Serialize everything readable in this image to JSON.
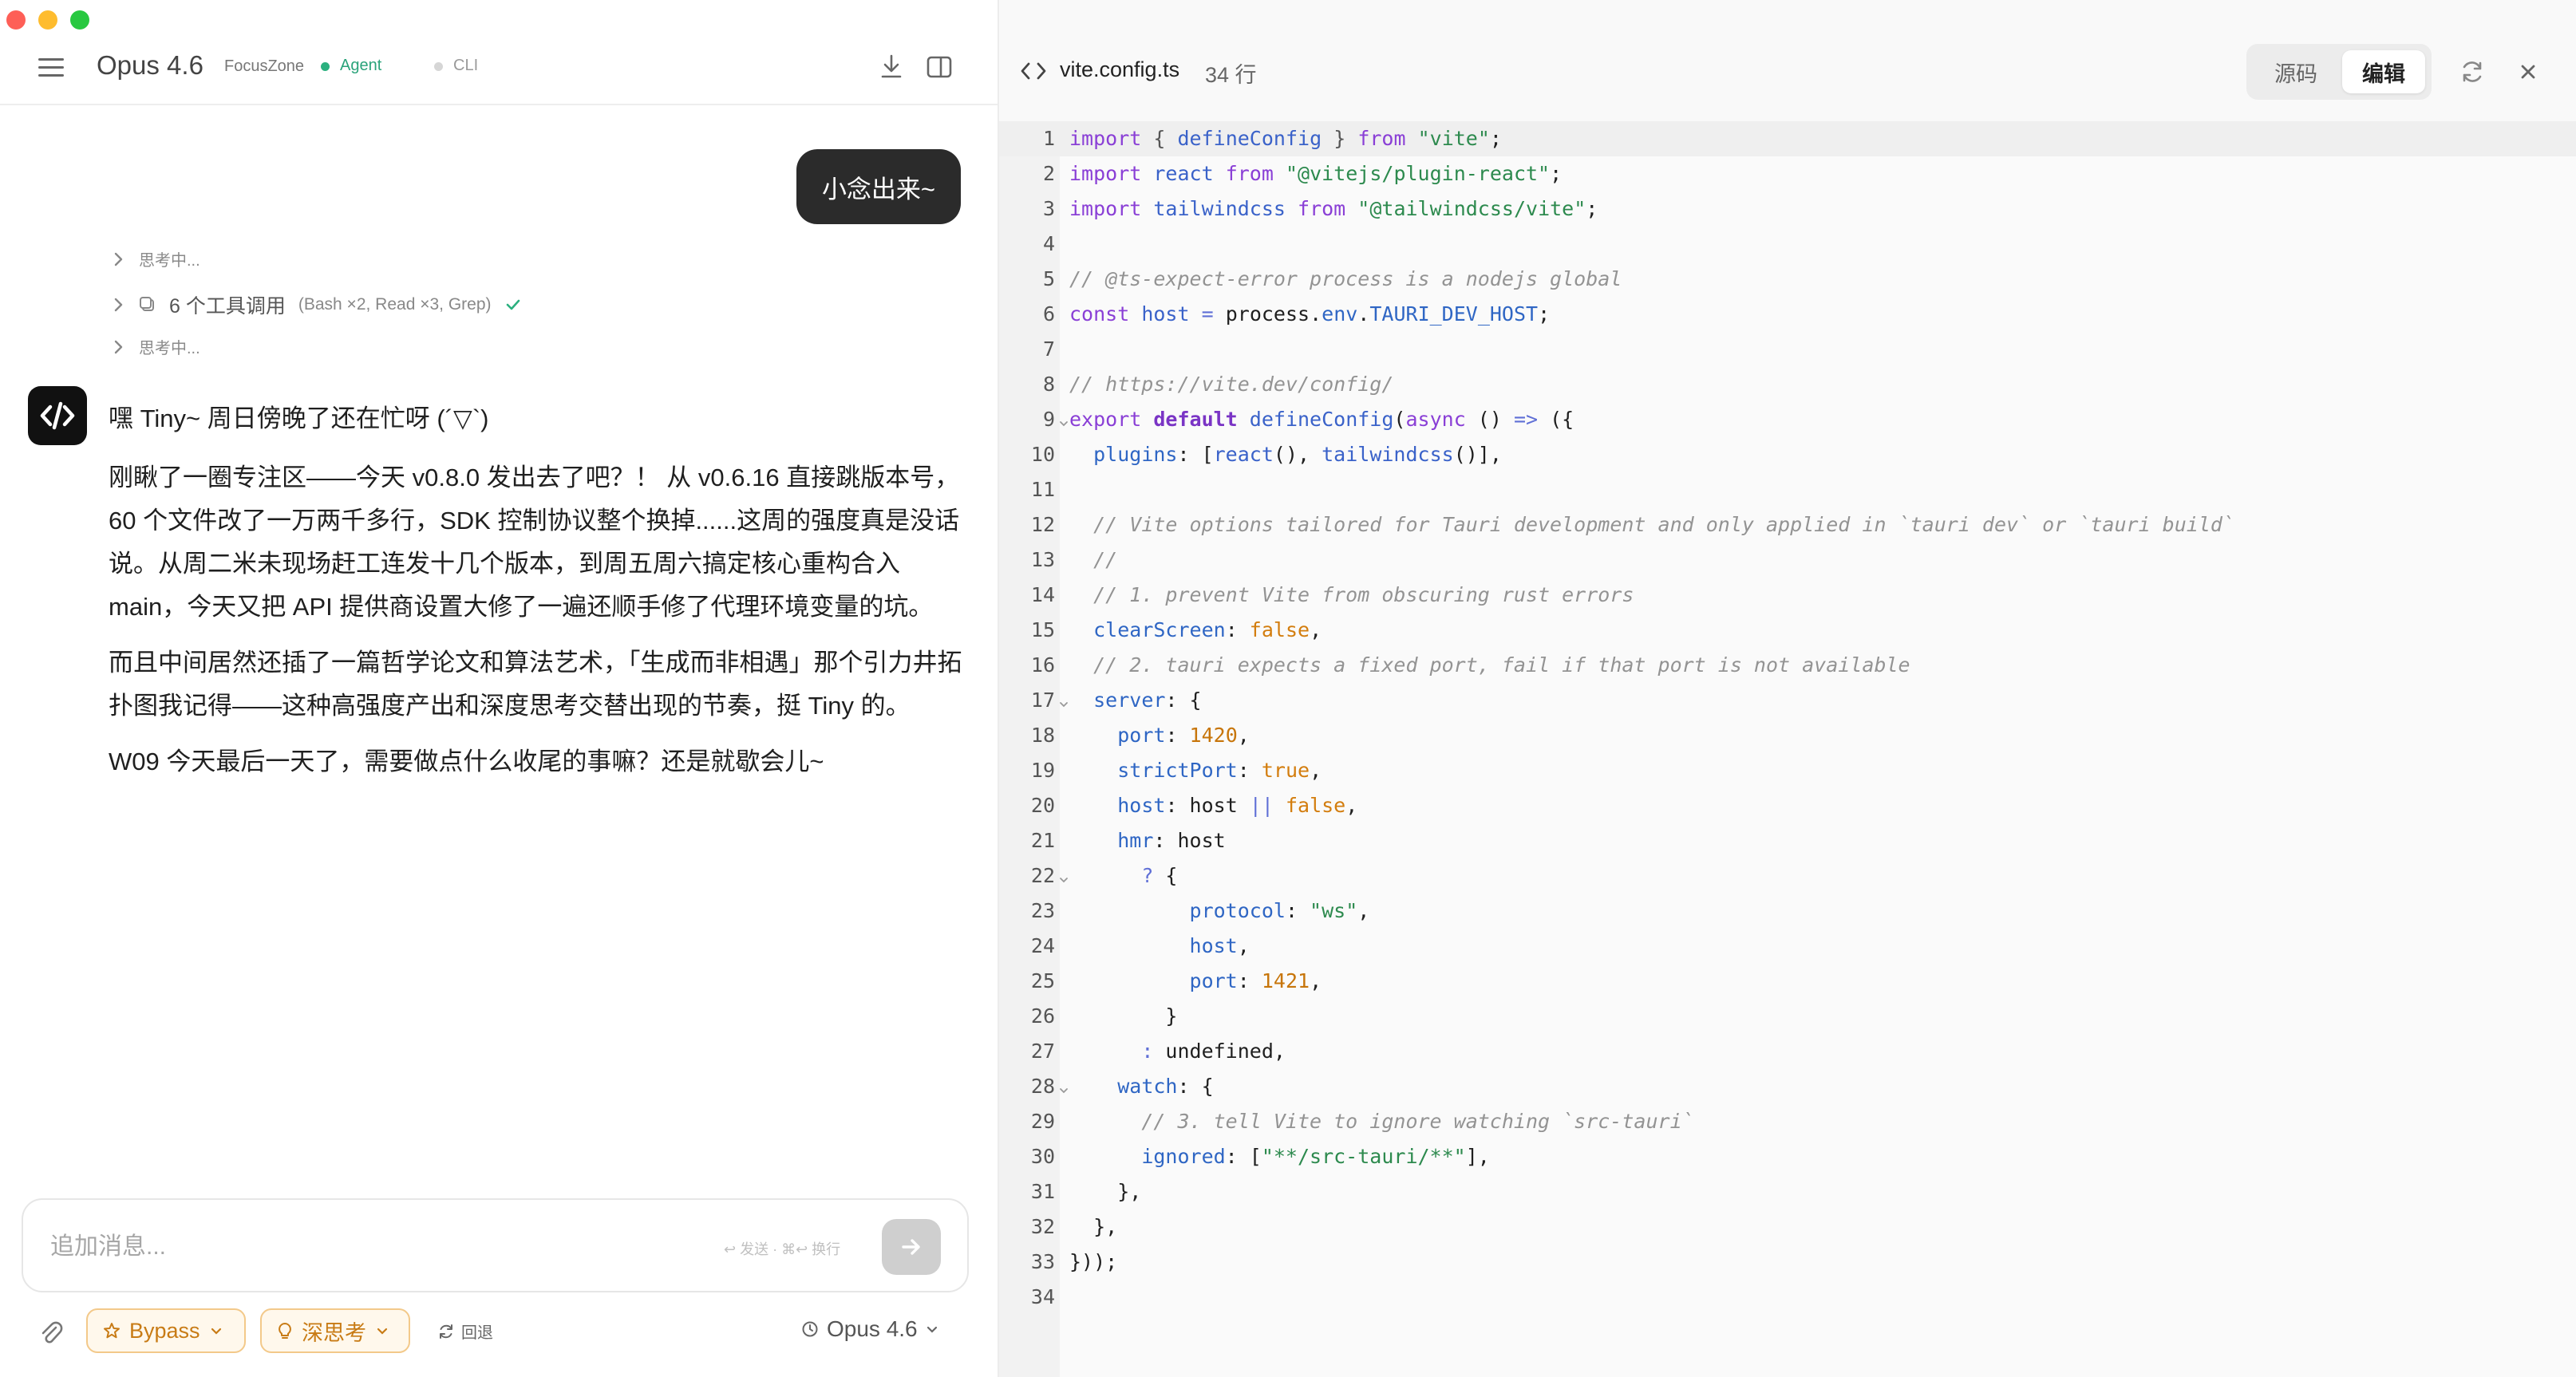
{
  "chat": {
    "header": {
      "model_title": "Opus 4.6",
      "project": "FocusZone",
      "mode_agent": "Agent",
      "mode_cli": "CLI"
    },
    "user_message": "小念出来~",
    "steps": {
      "thinking_1": "思考中...",
      "tool_label": "6 个工具调用",
      "tool_args": "(Bash ×2, Read ×3, Grep)",
      "thinking_2": "思考中..."
    },
    "assistant": {
      "greeting": "嘿 Tiny~ 周日傍晚了还在忙呀 (´▽`)",
      "para1": "刚瞅了一圈专注区——今天 v0.8.0 发出去了吧？！ 从 v0.6.16 直接跳版本号，60 个文件改了一万两千多行，SDK 控制协议整个换掉......这周的强度真是没话说。从周二米未现场赶工连发十几个版本，到周五周六搞定核心重构合入 main，今天又把 API 提供商设置大修了一遍还顺手修了代理环境变量的坑。",
      "para2": "而且中间居然还插了一篇哲学论文和算法艺术，「生成而非相遇」那个引力井拓扑图我记得——这种高强度产出和深度思考交替出现的节奏，挺 Tiny 的。",
      "para3": "W09 今天最后一天了，需要做点什么收尾的事嘛？还是就歇会儿~"
    },
    "composer": {
      "placeholder": "追加消息...",
      "hint": "↩ 发送 · ⌘↩ 换行"
    },
    "bottom": {
      "bypass": "Bypass",
      "think": "深思考",
      "rollback": "回退",
      "model": "Opus 4.6"
    }
  },
  "editor": {
    "file_name": "vite.config.ts",
    "line_count": "34 行",
    "view_source": "源码",
    "view_edit": "编辑",
    "lines": [
      {
        "n": "1",
        "active": true,
        "html": "<span class='kw'>import</span> <span class='pun'>{</span> <span class='fn'>defineConfig</span> <span class='pun'>}</span> <span class='kw'>from</span> <span class='str'>\"vite\"</span>;"
      },
      {
        "n": "2",
        "html": "<span class='kw'>import</span> <span class='fn'>react</span> <span class='kw'>from</span> <span class='str'>\"@vitejs/plugin-react\"</span>;"
      },
      {
        "n": "3",
        "html": "<span class='kw'>import</span> <span class='fn'>tailwindcss</span> <span class='kw'>from</span> <span class='str'>\"@tailwindcss/vite\"</span>;"
      },
      {
        "n": "4",
        "html": ""
      },
      {
        "n": "5",
        "html": "<span class='cm'>// @ts-expect-error process is a nodejs global</span>"
      },
      {
        "n": "6",
        "html": "<span class='kw'>const</span> <span class='fn'>host</span> <span class='op'>=</span> process.<span class='prop'>env</span>.<span class='prop'>TAURI_DEV_HOST</span>;"
      },
      {
        "n": "7",
        "html": ""
      },
      {
        "n": "8",
        "html": "<span class='cm'>// https://vite.dev/config/</span>"
      },
      {
        "n": "9",
        "fold": true,
        "html": "<span class='kw'>export</span> <span class='kw2'>default</span> <span class='fn'>defineConfig</span>(<span class='kw'>async</span> () <span class='op'>=&gt;</span> ({"
      },
      {
        "n": "10",
        "html": "  <span class='prop'>plugins</span>: [<span class='fn'>react</span>(), <span class='fn'>tailwindcss</span>()],"
      },
      {
        "n": "11",
        "html": ""
      },
      {
        "n": "12",
        "html": "  <span class='cm'>// Vite options tailored for Tauri development and only applied in `tauri dev` or `tauri build`</span>"
      },
      {
        "n": "13",
        "html": "  <span class='cm'>//</span>"
      },
      {
        "n": "14",
        "html": "  <span class='cm'>// 1. prevent Vite from obscuring rust errors</span>"
      },
      {
        "n": "15",
        "html": "  <span class='prop'>clearScreen</span>: <span class='bool'>false</span>,"
      },
      {
        "n": "16",
        "html": "  <span class='cm'>// 2. tauri expects a fixed port, fail if that port is not available</span>"
      },
      {
        "n": "17",
        "fold": true,
        "html": "  <span class='prop'>server</span>: {"
      },
      {
        "n": "18",
        "html": "    <span class='prop'>port</span>: <span class='num'>1420</span>,"
      },
      {
        "n": "19",
        "html": "    <span class='prop'>strictPort</span>: <span class='bool'>true</span>,"
      },
      {
        "n": "20",
        "html": "    <span class='prop'>host</span>: host <span class='op'>||</span> <span class='bool'>false</span>,"
      },
      {
        "n": "21",
        "html": "    <span class='prop'>hmr</span>: host"
      },
      {
        "n": "22",
        "fold": true,
        "html": "      <span class='op'>?</span> {"
      },
      {
        "n": "23",
        "html": "          <span class='prop'>protocol</span>: <span class='str'>\"ws\"</span>,"
      },
      {
        "n": "24",
        "html": "          <span class='prop'>host</span>,"
      },
      {
        "n": "25",
        "html": "          <span class='prop'>port</span>: <span class='num'>1421</span>,"
      },
      {
        "n": "26",
        "html": "        }"
      },
      {
        "n": "27",
        "html": "      <span class='op'>:</span> undefined,"
      },
      {
        "n": "28",
        "fold": true,
        "html": "    <span class='prop'>watch</span>: {"
      },
      {
        "n": "29",
        "html": "      <span class='cm'>// 3. tell Vite to ignore watching `src-tauri`</span>"
      },
      {
        "n": "30",
        "html": "      <span class='prop'>ignored</span>: [<span class='str'>\"**/src-tauri/**\"</span>],"
      },
      {
        "n": "31",
        "html": "    },"
      },
      {
        "n": "32",
        "html": "  },"
      },
      {
        "n": "33",
        "html": "}));"
      },
      {
        "n": "34",
        "html": ""
      }
    ]
  },
  "colors": {
    "agent_green": "#2bb07f",
    "accent_orange": "#c87b15",
    "user_bubble": "#2b2b2b"
  }
}
